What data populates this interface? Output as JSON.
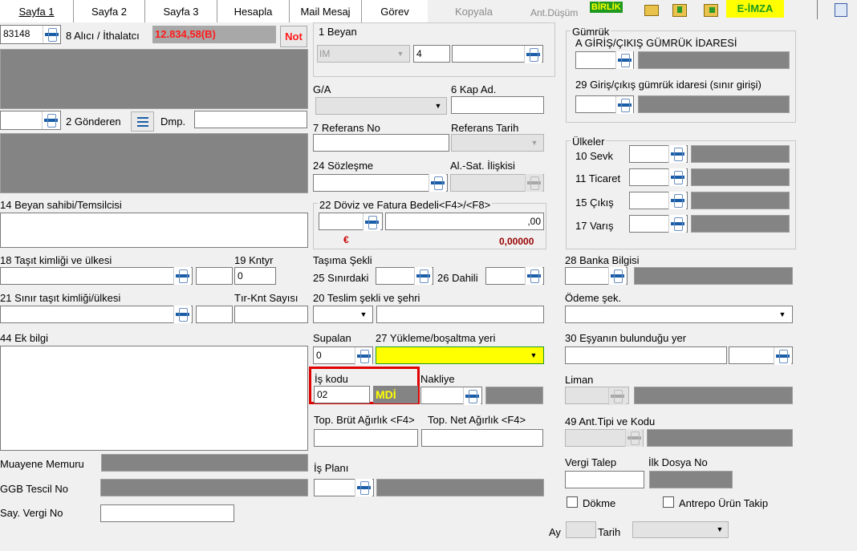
{
  "tabs": [
    "Sayfa 1",
    "Sayfa 2",
    "Sayfa 3",
    "Hesapla",
    "Mail Mesaj",
    "Görev",
    "Kopyala",
    "Ant.Düşüm",
    "BİRLİK",
    "E-İMZA"
  ],
  "left": {
    "alici_code": "83148",
    "alici_label": "8 Alıcı / İthalatcı",
    "amount": "12.834,58(B)",
    "not_label": "Not",
    "gonderen_label": "2 Gönderen",
    "dmp_label": "Dmp.",
    "beyan_sahibi_label": "14 Beyan sahibi/Temsilcisi",
    "tasit_label": "18 Taşıt kimliği ve ülkesi",
    "kntyr_label": "19 Kntyr",
    "kntyr_value": "0",
    "sinir_label": "21 Sınır taşıt kimliği/ülkesi",
    "tir_label": "Tır-Knt Sayısı",
    "ek_bilgi_label": "44 Ek bilgi",
    "muayene_label": "Muayene Memuru",
    "ggb_label": "GGB Tescil No",
    "say_vergi_label": "Say. Vergi No"
  },
  "middle": {
    "beyan_label": "1 Beyan",
    "beyan_select": "IM",
    "beyan_num": "4",
    "ga_label": "G/A",
    "kap_label": "6 Kap Ad.",
    "referans_label": "7 Referans No",
    "referans_tarih_label": "Referans Tarih",
    "sozlesme_label": "24 Sözleşme",
    "al_sat_label": "Al.-Sat. İlişkisi",
    "doviz_label": "22 Döviz ve Fatura Bedeli<F4>/<F8>",
    "doviz_value": ",00",
    "euro_symbol": "€",
    "rate": "0,00000",
    "tasima_label": "Taşıma Şekli",
    "sinirdaki_label": "25 Sınırdaki",
    "dahili_label": "26 Dahili",
    "teslim_label": "20 Teslim şekli ve şehri",
    "supalan_label": "Supalan",
    "supalan_value": "0",
    "yukleme_label": "27 Yükleme/boşaltma yeri",
    "is_kodu_label": "İş kodu",
    "is_kodu_value": "02",
    "mdi": "MDİ",
    "nakliye_label": "Nakliye",
    "brut_label": "Top. Brüt Ağırlık <F4>",
    "net_label": "Top. Net Ağırlık <F4>",
    "is_plani_label": "İş Planı"
  },
  "right": {
    "gumruk_title": "Gümrük",
    "giris_cikis_label": "A GİRİŞ/ÇIKIŞ GÜMRÜK İDARESİ",
    "giris_label": "29 Giriş/çıkış gümrük idaresi (sınır girişi)",
    "ulkeler_title": "Ülkeler",
    "sevk_label": "10 Sevk",
    "ticaret_label": "11 Ticaret",
    "cikis_label": "15 Çıkış",
    "varis_label": "17 Varış",
    "banka_label": "28 Banka Bilgisi",
    "odeme_label": "Ödeme şek.",
    "esya_label": "30 Eşyanın bulunduğu yer",
    "liman_label": "Liman",
    "ant_tipi_label": "49 Ant.Tipi ve Kodu",
    "vergi_talep_label": "Vergi Talep",
    "ilk_dosya_label": "İlk Dosya No",
    "dokme_label": "Dökme",
    "antrepo_label": "Antrepo Ürün Takip",
    "ay_label": "Ay",
    "tarih_label": "Tarih"
  },
  "colors": {
    "highlight_yellow": "#ffff00",
    "red_border": "#e00000",
    "amount_red": "#ff1a1a",
    "birlik_green": "#1f9a1f"
  }
}
